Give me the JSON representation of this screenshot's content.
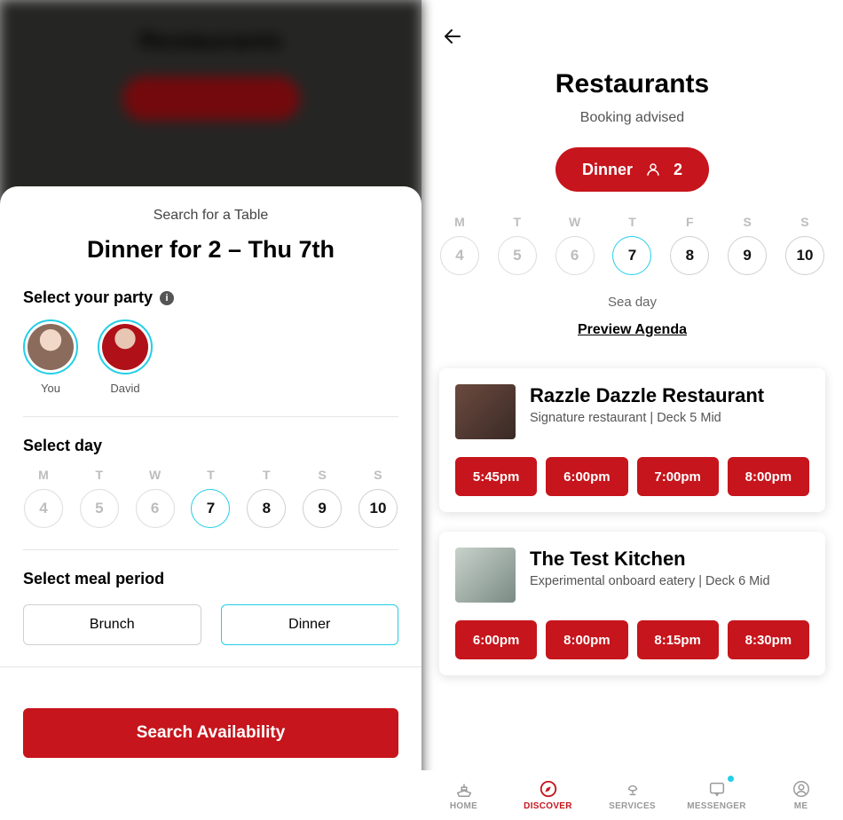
{
  "left": {
    "backdrop_title": "Restaurants",
    "sheet": {
      "subtitle": "Search for a Table",
      "title": "Dinner for 2 – Thu 7th",
      "party_label": "Select your party",
      "party": [
        {
          "name": "You"
        },
        {
          "name": "David"
        }
      ],
      "day_label": "Select day",
      "days": [
        {
          "letter": "M",
          "num": "4",
          "state": "off"
        },
        {
          "letter": "T",
          "num": "5",
          "state": "off"
        },
        {
          "letter": "W",
          "num": "6",
          "state": "off"
        },
        {
          "letter": "T",
          "num": "7",
          "state": "selected"
        },
        {
          "letter": "T",
          "num": "8",
          "state": "on"
        },
        {
          "letter": "S",
          "num": "9",
          "state": "on"
        },
        {
          "letter": "S",
          "num": "10",
          "state": "on"
        }
      ],
      "meal_label": "Select meal period",
      "meals": [
        {
          "label": "Brunch",
          "selected": false
        },
        {
          "label": "Dinner",
          "selected": true
        }
      ],
      "search_label": "Search Availability"
    }
  },
  "right": {
    "title": "Restaurants",
    "subtitle": "Booking advised",
    "pill": {
      "meal": "Dinner",
      "count": "2"
    },
    "days": [
      {
        "letter": "M",
        "num": "4",
        "state": "off"
      },
      {
        "letter": "T",
        "num": "5",
        "state": "off"
      },
      {
        "letter": "W",
        "num": "6",
        "state": "off"
      },
      {
        "letter": "T",
        "num": "7",
        "state": "selected"
      },
      {
        "letter": "F",
        "num": "8",
        "state": "on"
      },
      {
        "letter": "S",
        "num": "9",
        "state": "on"
      },
      {
        "letter": "S",
        "num": "10",
        "state": "on"
      }
    ],
    "sea_day": "Sea day",
    "preview": "Preview Agenda",
    "restaurants": [
      {
        "name": "Razzle Dazzle Restaurant",
        "meta": "Signature restaurant | Deck 5 Mid",
        "thumb": "razzle",
        "slots": [
          "5:45pm",
          "6:00pm",
          "7:00pm",
          "8:00pm"
        ]
      },
      {
        "name": "The Test Kitchen",
        "meta": "Experimental onboard eatery | Deck 6 Mid",
        "thumb": "test",
        "slots": [
          "6:00pm",
          "8:00pm",
          "8:15pm",
          "8:30pm"
        ]
      }
    ]
  },
  "nav": {
    "items": [
      {
        "label": "HOME",
        "icon": "ship",
        "active": false
      },
      {
        "label": "DISCOVER",
        "icon": "compass",
        "active": true
      },
      {
        "label": "SERVICES",
        "icon": "lamp",
        "active": false
      },
      {
        "label": "MESSENGER",
        "icon": "chat",
        "active": false,
        "dot": true
      },
      {
        "label": "ME",
        "icon": "person",
        "active": false
      }
    ]
  }
}
